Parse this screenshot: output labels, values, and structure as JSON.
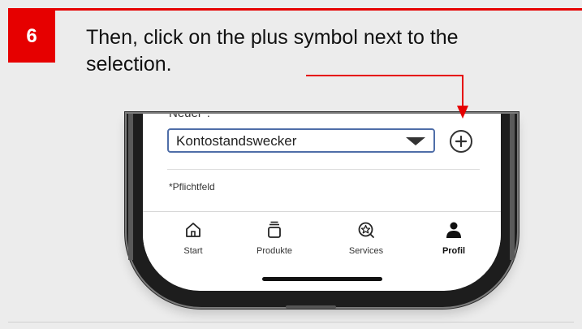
{
  "step": {
    "number": "6"
  },
  "instruction": "Then, click on the plus symbol next to the selection.",
  "form": {
    "field_label": "Neuer*:",
    "selected_value": "Kontostandswecker",
    "required_note": "*Pflichtfeld"
  },
  "nav": {
    "items": [
      {
        "label": "Start",
        "icon": "home-icon",
        "active": false
      },
      {
        "label": "Produkte",
        "icon": "stack-icon",
        "active": false
      },
      {
        "label": "Services",
        "icon": "services-star-icon",
        "active": false
      },
      {
        "label": "Profil",
        "icon": "profile-icon",
        "active": true
      }
    ]
  },
  "colors": {
    "accent": "#e60000",
    "select_border": "#4f6ea8",
    "background": "#ececec"
  }
}
